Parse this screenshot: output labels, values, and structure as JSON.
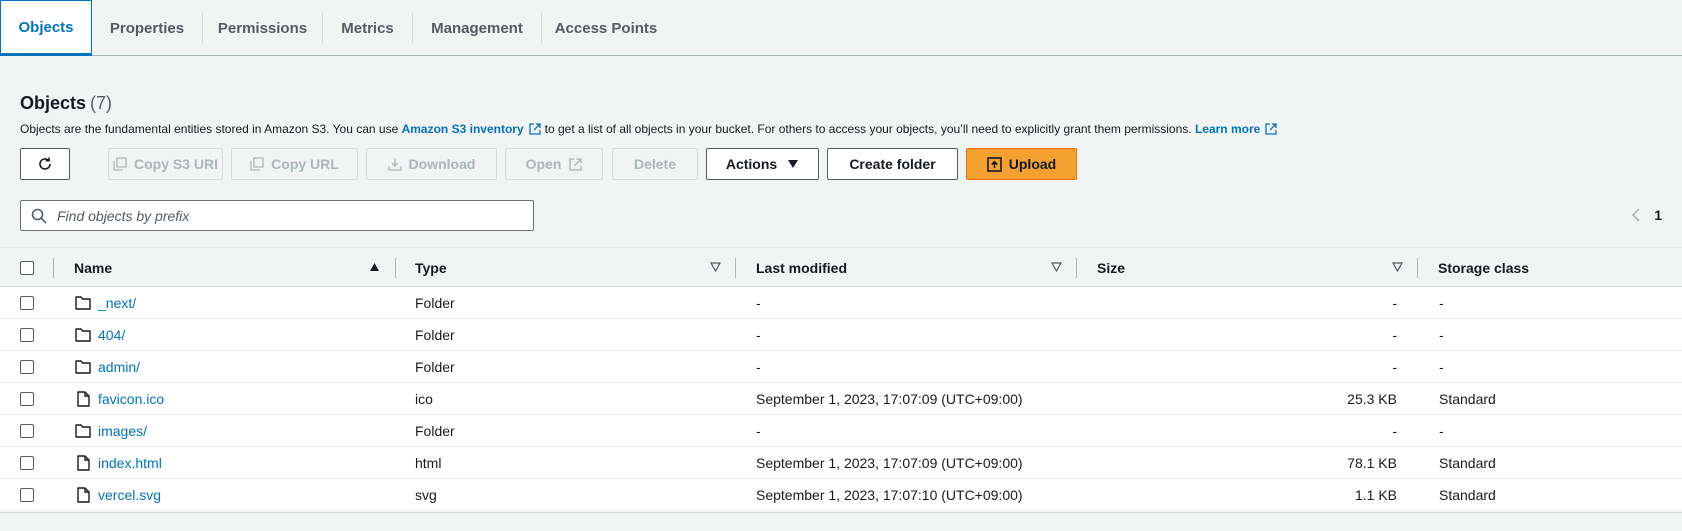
{
  "tabs": [
    {
      "label": "Objects",
      "active": true
    },
    {
      "label": "Properties",
      "active": false
    },
    {
      "label": "Permissions",
      "active": false
    },
    {
      "label": "Metrics",
      "active": false
    },
    {
      "label": "Management",
      "active": false
    },
    {
      "label": "Access Points",
      "active": false
    }
  ],
  "panel": {
    "title": "Objects",
    "count": "(7)",
    "desc_before": "Objects are the fundamental entities stored in Amazon S3. You can use",
    "inventory_link": "Amazon S3 inventory",
    "desc_middle": "to get a list of all objects in your bucket. For others to access your objects, you’ll need to explicitly grant them permissions.",
    "learn_more": "Learn more"
  },
  "toolbar": {
    "refresh_icon": "refresh-icon",
    "copy_s3_uri": "Copy S3 URI",
    "copy_url": "Copy URL",
    "download": "Download",
    "open": "Open",
    "delete": "Delete",
    "actions": "Actions",
    "create_folder": "Create folder",
    "upload": "Upload"
  },
  "search": {
    "placeholder": "Find objects by prefix"
  },
  "pagination": {
    "page": "1"
  },
  "table": {
    "columns": {
      "name": "Name",
      "type": "Type",
      "last_modified": "Last modified",
      "size": "Size",
      "storage_class": "Storage class"
    },
    "rows": [
      {
        "icon": "folder-icon",
        "name": "_next/",
        "type": "Folder",
        "last_modified": "-",
        "size": "-",
        "storage_class": "-"
      },
      {
        "icon": "folder-icon",
        "name": "404/",
        "type": "Folder",
        "last_modified": "-",
        "size": "-",
        "storage_class": "-"
      },
      {
        "icon": "folder-icon",
        "name": "admin/",
        "type": "Folder",
        "last_modified": "-",
        "size": "-",
        "storage_class": "-"
      },
      {
        "icon": "file-icon",
        "name": "favicon.ico",
        "type": "ico",
        "last_modified": "September 1, 2023, 17:07:09 (UTC+09:00)",
        "size": "25.3 KB",
        "storage_class": "Standard"
      },
      {
        "icon": "folder-icon",
        "name": "images/",
        "type": "Folder",
        "last_modified": "-",
        "size": "-",
        "storage_class": "-"
      },
      {
        "icon": "file-icon",
        "name": "index.html",
        "type": "html",
        "last_modified": "September 1, 2023, 17:07:09 (UTC+09:00)",
        "size": "78.1 KB",
        "storage_class": "Standard"
      },
      {
        "icon": "file-icon",
        "name": "vercel.svg",
        "type": "svg",
        "last_modified": "September 1, 2023, 17:07:10 (UTC+09:00)",
        "size": "1.1 KB",
        "storage_class": "Standard"
      }
    ]
  },
  "colors": {
    "accent": "#0073bb",
    "primary_button": "#f5a131",
    "background": "#f2f3f3"
  }
}
